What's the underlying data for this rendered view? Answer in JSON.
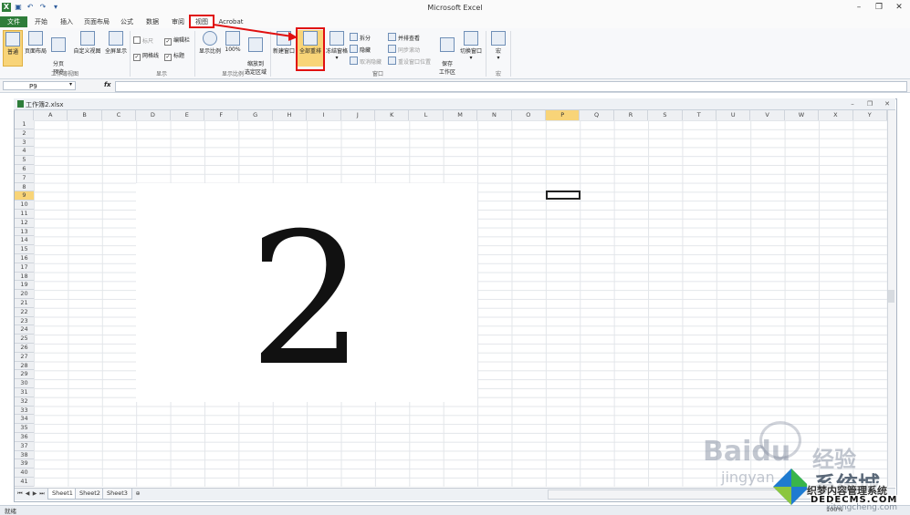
{
  "app": {
    "title": "Microsoft Excel",
    "qat": {
      "save_icon": "save-icon",
      "undo_icon": "undo-icon",
      "redo_icon": "redo-icon"
    }
  },
  "window_buttons": {
    "minimize": "–",
    "restore": "❐",
    "close": "✕"
  },
  "tabs": [
    {
      "label": "文件"
    },
    {
      "label": "开始"
    },
    {
      "label": "插入"
    },
    {
      "label": "页面布局"
    },
    {
      "label": "公式"
    },
    {
      "label": "数据"
    },
    {
      "label": "审阅"
    },
    {
      "label": "视图"
    },
    {
      "label": "Acrobat"
    }
  ],
  "ribbon": {
    "workbook_views": {
      "label": "工作簿视图",
      "normal": "普通",
      "page_layout": "页面布局",
      "page_break": "分页\n预览",
      "custom_views": "自定义视图",
      "full_screen": "全屏显示"
    },
    "show": {
      "label": "显示",
      "ruler": "标尺",
      "formula_bar": "编辑栏",
      "gridlines": "网格线",
      "headings": "标题"
    },
    "zoom": {
      "label": "显示比例",
      "zoom": "显示比例",
      "hundred": "100%",
      "zoom_selection": "缩放到\n选定区域"
    },
    "window": {
      "label": "窗口",
      "new_window": "新建窗口",
      "arrange_all": "全部重排",
      "freeze_panes": "冻结窗格",
      "split": "拆分",
      "hide": "隐藏",
      "unhide": "取消隐藏",
      "side_by_side": "并排查看",
      "sync_scroll": "同步滚动",
      "reset_position": "重设窗口位置",
      "save_workspace": "保存\n工作区",
      "switch_windows": "切换窗口"
    },
    "macros": {
      "label": "宏",
      "macros": "宏"
    }
  },
  "formula_bar": {
    "name_box": "P9",
    "fx": "fx",
    "formula": ""
  },
  "workbook": {
    "title": "工作簿2.xlsx"
  },
  "columns": [
    "A",
    "B",
    "C",
    "D",
    "E",
    "F",
    "G",
    "H",
    "I",
    "J",
    "K",
    "L",
    "M",
    "N",
    "O",
    "P",
    "Q",
    "R",
    "S",
    "T",
    "U",
    "V",
    "W",
    "X",
    "Y"
  ],
  "selected_column": "P",
  "rows": [
    "1",
    "2",
    "3",
    "4",
    "5",
    "6",
    "7",
    "8",
    "9",
    "10",
    "11",
    "12",
    "13",
    "14",
    "15",
    "16",
    "17",
    "18",
    "19",
    "20",
    "21",
    "22",
    "23",
    "24",
    "25",
    "26",
    "27",
    "28",
    "29",
    "30",
    "31",
    "32",
    "33",
    "34",
    "35",
    "36",
    "37",
    "38",
    "39",
    "40",
    "41"
  ],
  "selected_row": "9",
  "overlay_text": "2",
  "sheets": [
    "Sheet1",
    "Sheet2",
    "Sheet3"
  ],
  "status": {
    "ready": "就绪",
    "zoom": "100%"
  },
  "watermarks": {
    "baidu": "Bai",
    "baidu_du": "du",
    "jingyan": "经验",
    "jingyan_url": "jingyan",
    "xitong": "系统城",
    "xitong_url": "xitongcheng.com",
    "dedecms_cn": "织梦内容管理系统",
    "dedecms": "DEDECMS.COM"
  },
  "colors": {
    "file_tab": "#2e7d3a",
    "highlight": "#f8d478",
    "annotation": "#e01010"
  }
}
